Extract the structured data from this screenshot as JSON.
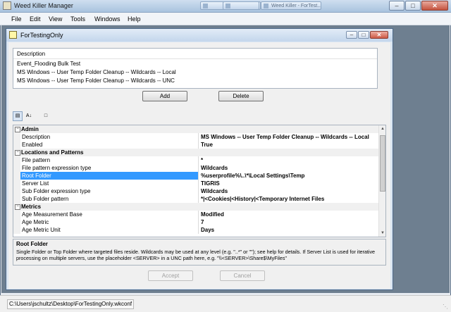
{
  "app": {
    "title": "Weed Killer Manager",
    "ghost_tabs": [
      "",
      "",
      "Weed Killer - ForTest..."
    ]
  },
  "menu": [
    "File",
    "Edit",
    "View",
    "Tools",
    "Windows",
    "Help"
  ],
  "child": {
    "title": "ForTestingOnly",
    "list": {
      "header": "Description",
      "items": [
        "Event_Flooding Bulk Test",
        "MS Windows -- User Temp Folder Cleanup -- Wildcards -- Local",
        "MS Windows -- User Temp Folder Cleanup -- Wildcards -- UNC"
      ]
    },
    "add_label": "Add",
    "delete_label": "Delete",
    "grid": {
      "rows": [
        {
          "kind": "cat",
          "name": "Admin"
        },
        {
          "kind": "prop",
          "name": "Description",
          "value": "MS Windows -- User Temp Folder Cleanup -- Wildcards -- Local"
        },
        {
          "kind": "prop",
          "name": "Enabled",
          "value": "True"
        },
        {
          "kind": "cat",
          "name": "Locations and Patterns"
        },
        {
          "kind": "prop",
          "name": "File pattern",
          "value": "*"
        },
        {
          "kind": "prop",
          "name": "File pattern expression type",
          "value": "Wildcards"
        },
        {
          "kind": "prop",
          "name": "Root Folder",
          "value": "%userprofile%\\..\\*\\Local Settings\\Temp",
          "selected": true
        },
        {
          "kind": "prop",
          "name": "Server List",
          "value": "TIGRIS"
        },
        {
          "kind": "prop",
          "name": "Sub Folder expression type",
          "value": "Wildcards"
        },
        {
          "kind": "prop",
          "name": "Sub Folder pattern",
          "value": "*|<Cookies|<History|<Temporary Internet Files"
        },
        {
          "kind": "cat",
          "name": "Metrics"
        },
        {
          "kind": "prop",
          "name": "Age Measurement Base",
          "value": "Modified"
        },
        {
          "kind": "prop",
          "name": "Age Metric",
          "value": "7"
        },
        {
          "kind": "prop",
          "name": "Age Metric Unit",
          "value": "Days"
        }
      ]
    },
    "help": {
      "title": "Root Folder",
      "description": "Single Folder or Top Folder where targeted files reside.  Wildcards may be used at any level (e.g. \"..*\" or \"\"); see help for details.  If Server List is used for iterative processing on multiple servers, use the placeholder <SERVER> in a UNC path here, e.g. \"\\\\<SERVER>\\Share$\\MyFiles\""
    },
    "accept_label": "Accept",
    "cancel_label": "Cancel"
  },
  "status": {
    "path": "C:\\Users\\jschultz\\Desktop\\ForTestingOnly.wkconf"
  }
}
